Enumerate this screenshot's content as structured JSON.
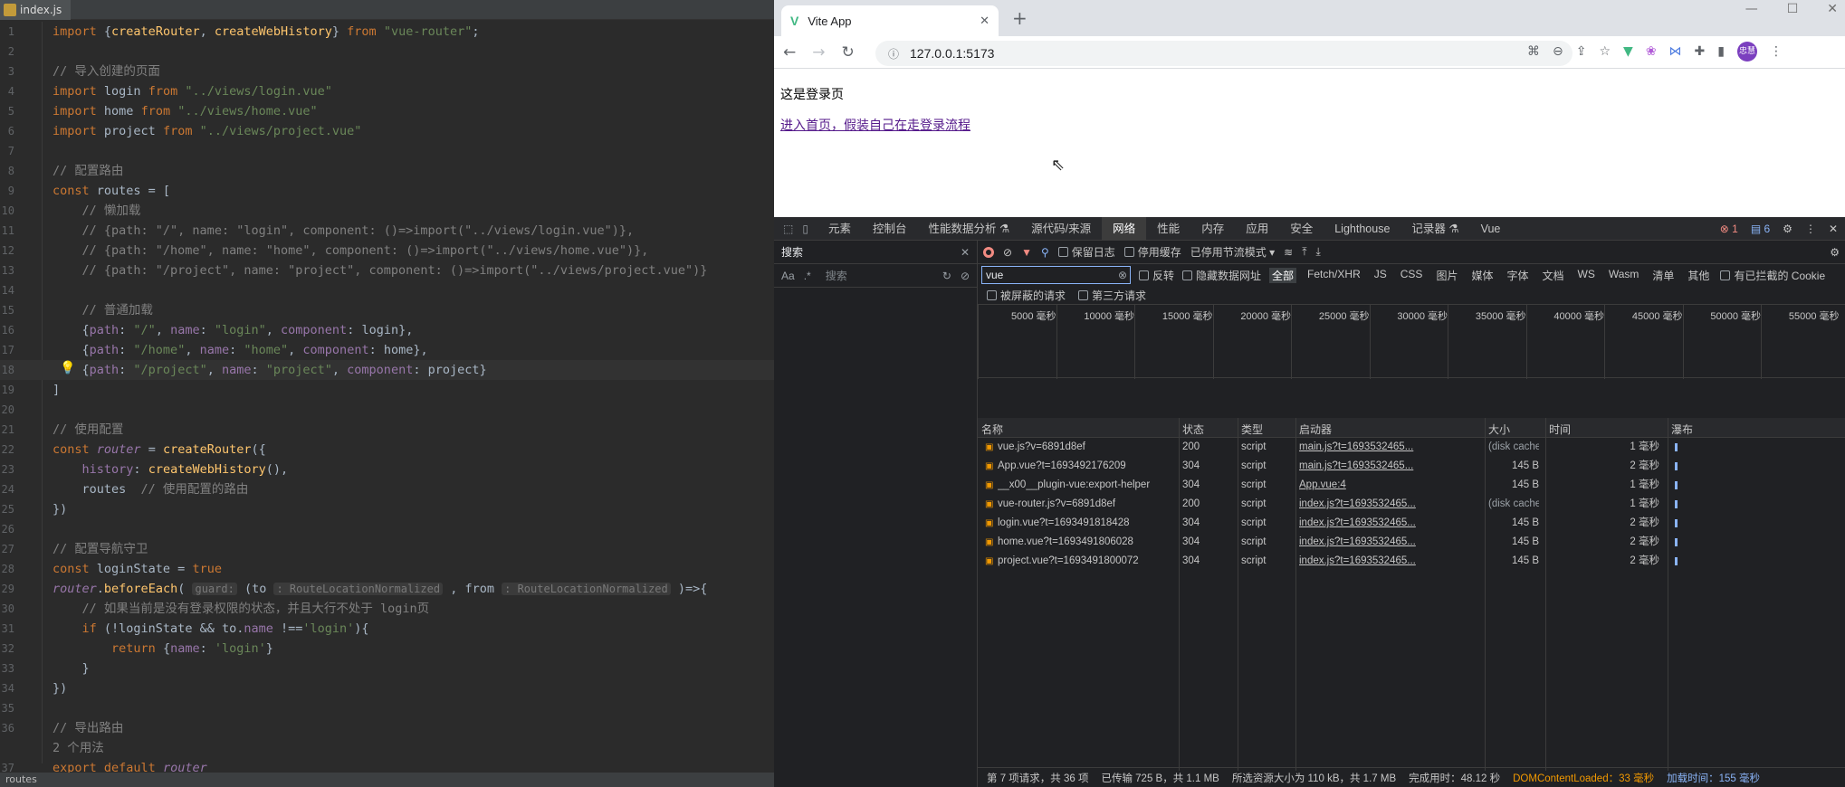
{
  "editor": {
    "tab_title": "index.js",
    "status_text": "routes",
    "lines": [
      {
        "n": "1",
        "html": "<span class='kw'>import</span> {<span class='fn'>createRouter</span>, <span class='fn'>createWebHistory</span>} <span class='kw'>from</span> <span class='str'>\"vue-router\"</span>;"
      },
      {
        "n": "2",
        "html": ""
      },
      {
        "n": "3",
        "html": "<span class='cm'>// 导入创建的页面</span>"
      },
      {
        "n": "4",
        "html": "<span class='kw'>import</span> login <span class='kw'>from</span> <span class='str'>\"../views/login.vue\"</span>"
      },
      {
        "n": "5",
        "html": "<span class='kw'>import</span> home <span class='kw'>from</span> <span class='str'>\"../views/home.vue\"</span>"
      },
      {
        "n": "6",
        "html": "<span class='kw'>import</span> project <span class='kw'>from</span> <span class='str'>\"../views/project.vue\"</span>"
      },
      {
        "n": "7",
        "html": ""
      },
      {
        "n": "8",
        "html": "<span class='cm'>// 配置路由</span>"
      },
      {
        "n": "9",
        "html": "<span class='kw'>const</span> routes = ["
      },
      {
        "n": "10",
        "html": "    <span class='cm'>// 懒加载</span>"
      },
      {
        "n": "11",
        "html": "    <span class='cm'>// {path: \"/\", name: \"login\", component: ()=>import(\"../views/login.vue\")},</span>"
      },
      {
        "n": "12",
        "html": "    <span class='cm'>// {path: \"/home\", name: \"home\", component: ()=>import(\"../views/home.vue\")},</span>"
      },
      {
        "n": "13",
        "html": "    <span class='cm'>// {path: \"/project\", name: \"project\", component: ()=>import(\"../views/project.vue\")}</span>"
      },
      {
        "n": "14",
        "html": ""
      },
      {
        "n": "15",
        "html": "    <span class='cm'>// 普通加载</span>"
      },
      {
        "n": "16",
        "html": "    {<span class='prop'>path</span>: <span class='str'>\"/\"</span>, <span class='prop'>name</span>: <span class='str'>\"login\"</span>, <span class='prop'>component</span>: login},"
      },
      {
        "n": "17",
        "html": "    {<span class='prop'>path</span>: <span class='str'>\"/home\"</span>, <span class='prop'>name</span>: <span class='str'>\"home\"</span>, <span class='prop'>component</span>: home},"
      },
      {
        "n": "18",
        "html": "    {<span class='prop'>path</span>: <span class='str'>\"/project\"</span>, <span class='prop'>name</span>: <span class='str'>\"project\"</span>, <span class='prop'>component</span>: project}",
        "cur": true
      },
      {
        "n": "19",
        "html": "]"
      },
      {
        "n": "20",
        "html": ""
      },
      {
        "n": "21",
        "html": "<span class='cm'>// 使用配置</span>"
      },
      {
        "n": "22",
        "html": "<span class='kw'>const</span> <span class='it'>router</span> = <span class='fn'>createRouter</span>({"
      },
      {
        "n": "23",
        "html": "    <span class='prop'>history</span>: <span class='fn'>createWebHistory</span>(),"
      },
      {
        "n": "24",
        "html": "    routes  <span class='cm'>// 使用配置的路由</span>"
      },
      {
        "n": "25",
        "html": "})"
      },
      {
        "n": "26",
        "html": ""
      },
      {
        "n": "27",
        "html": "<span class='cm'>// 配置导航守卫</span>"
      },
      {
        "n": "28",
        "html": "<span class='kw'>const</span> loginState = <span class='kw'>true</span>"
      },
      {
        "n": "29",
        "html": "<span class='it'>router</span>.<span class='fn'>beforeEach</span>( <span class='hint'>guard:</span> (to <span class='hint'>: RouteLocationNormalized</span> , from <span class='hint'>: RouteLocationNormalized</span> )=>{"
      },
      {
        "n": "30",
        "html": "    <span class='cm'>// 如果当前是没有登录权限的状态，并且大行不处于 login页</span>"
      },
      {
        "n": "31",
        "html": "    <span class='kw'>if</span> (!loginState &amp;&amp; to.<span class='prop'>name</span> !==<span class='str'>'login'</span>){"
      },
      {
        "n": "32",
        "html": "        <span class='kw'>return</span> {<span class='prop'>name</span>: <span class='str'>'login'</span>}"
      },
      {
        "n": "33",
        "html": "    }"
      },
      {
        "n": "34",
        "html": "})"
      },
      {
        "n": "35",
        "html": ""
      },
      {
        "n": "36",
        "html": "<span class='cm'>// 导出路由</span>"
      },
      {
        "n": "",
        "html": "<span class='cm'>2 个用法</span>"
      },
      {
        "n": "37",
        "html": "<span class='kw'>export default</span> <span class='it'>router</span>"
      }
    ]
  },
  "browser": {
    "tab_title": "Vite App",
    "tab_icon": "vue-logo-icon",
    "url": "127.0.0.1:5173",
    "avatar_text": "忠慧",
    "page_text": "这是登录页",
    "page_link": "进入首页，假装自己在走登录流程"
  },
  "devtools": {
    "tabs": [
      "元素",
      "控制台",
      "性能数据分析 ⚗",
      "源代码/来源",
      "网络",
      "性能",
      "内存",
      "应用",
      "安全",
      "Lighthouse",
      "记录器 ⚗",
      "Vue"
    ],
    "active_tab": "网络",
    "errors": "1",
    "messages": "6",
    "search_title": "搜索",
    "search_placeholder": "搜索",
    "search_aa": "Aa",
    "search_regex": ".*",
    "toolbar": {
      "preserve_log": "保留日志",
      "disable_cache": "停用缓存",
      "throttle": "已停用节流模式"
    },
    "filter_value": "vue",
    "filter_chips": {
      "invert": "反转",
      "hide_data": "隐藏数据网址",
      "all": "全部",
      "types": [
        "Fetch/XHR",
        "JS",
        "CSS",
        "图片",
        "媒体",
        "字体",
        "文档",
        "WS",
        "Wasm",
        "清单",
        "其他"
      ],
      "blocked_cookie": "有已拦截的 Cookie",
      "blocked_req": "被屏蔽的请求",
      "third_party": "第三方请求"
    },
    "timeline_ticks": [
      "5000 毫秒",
      "10000 毫秒",
      "15000 毫秒",
      "20000 毫秒",
      "25000 毫秒",
      "30000 毫秒",
      "35000 毫秒",
      "40000 毫秒",
      "45000 毫秒",
      "50000 毫秒",
      "55000 毫秒"
    ],
    "columns": [
      "名称",
      "状态",
      "类型",
      "启动器",
      "大小",
      "时间",
      "瀑布"
    ],
    "rows": [
      {
        "name": "vue.js?v=6891d8ef",
        "status": "200",
        "type": "script",
        "initiator": "main.js?t=1693532465...",
        "size": "(disk cache)",
        "time": "1 毫秒"
      },
      {
        "name": "App.vue?t=1693492176209",
        "status": "304",
        "type": "script",
        "initiator": "main.js?t=1693532465...",
        "size": "145 B",
        "time": "2 毫秒"
      },
      {
        "name": "__x00__plugin-vue:export-helper",
        "status": "304",
        "type": "script",
        "initiator": "App.vue:4",
        "size": "145 B",
        "time": "1 毫秒"
      },
      {
        "name": "vue-router.js?v=6891d8ef",
        "status": "200",
        "type": "script",
        "initiator": "index.js?t=1693532465...",
        "size": "(disk cache)",
        "time": "1 毫秒"
      },
      {
        "name": "login.vue?t=1693491818428",
        "status": "304",
        "type": "script",
        "initiator": "index.js?t=1693532465...",
        "size": "145 B",
        "time": "2 毫秒"
      },
      {
        "name": "home.vue?t=1693491806028",
        "status": "304",
        "type": "script",
        "initiator": "index.js?t=1693532465...",
        "size": "145 B",
        "time": "2 毫秒"
      },
      {
        "name": "project.vue?t=1693491800072",
        "status": "304",
        "type": "script",
        "initiator": "index.js?t=1693532465...",
        "size": "145 B",
        "time": "2 毫秒"
      }
    ],
    "status_bar": {
      "requests": "第 7 项请求，共 36 项",
      "transferred": "已传输 725 B，共 1.1 MB",
      "resources": "所选资源大小为 110 kB，共 1.7 MB",
      "finish": "完成用时：48.12 秒",
      "dcl": "DOMContentLoaded：33 毫秒",
      "load": "加载时间：155 毫秒"
    }
  }
}
